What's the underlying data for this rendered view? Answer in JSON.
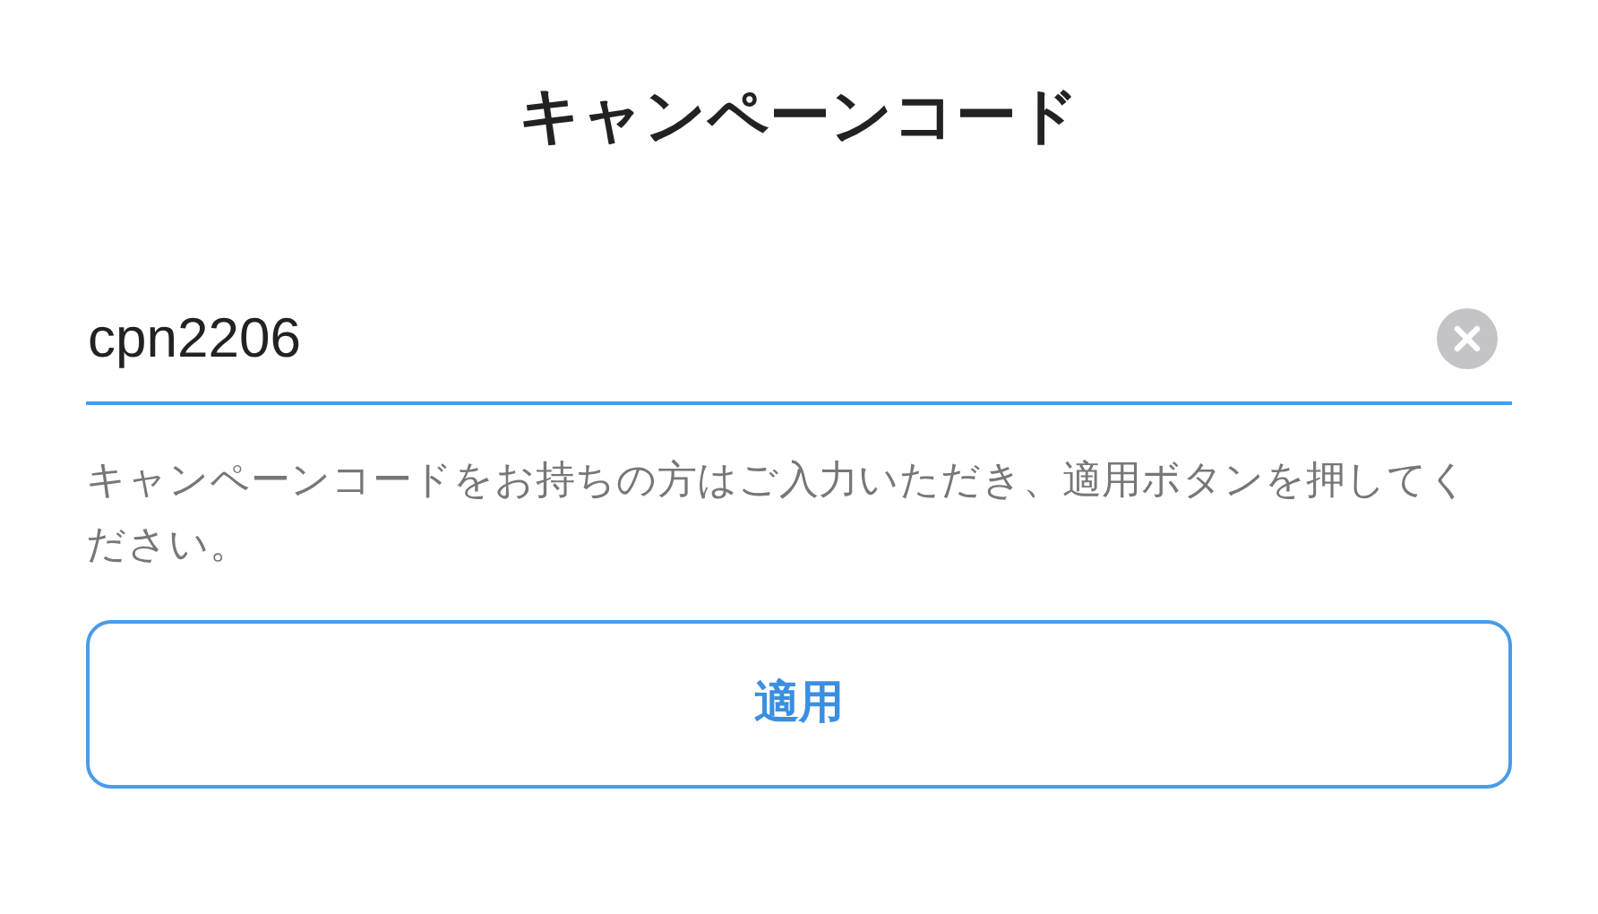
{
  "title": "キャンペーンコード",
  "code_field": {
    "value": "cpn2206"
  },
  "help_text": "キャンペーンコードをお持ちの方はご入力いただき、適用ボタンを押してください。",
  "apply_button": {
    "label": "適用"
  }
}
